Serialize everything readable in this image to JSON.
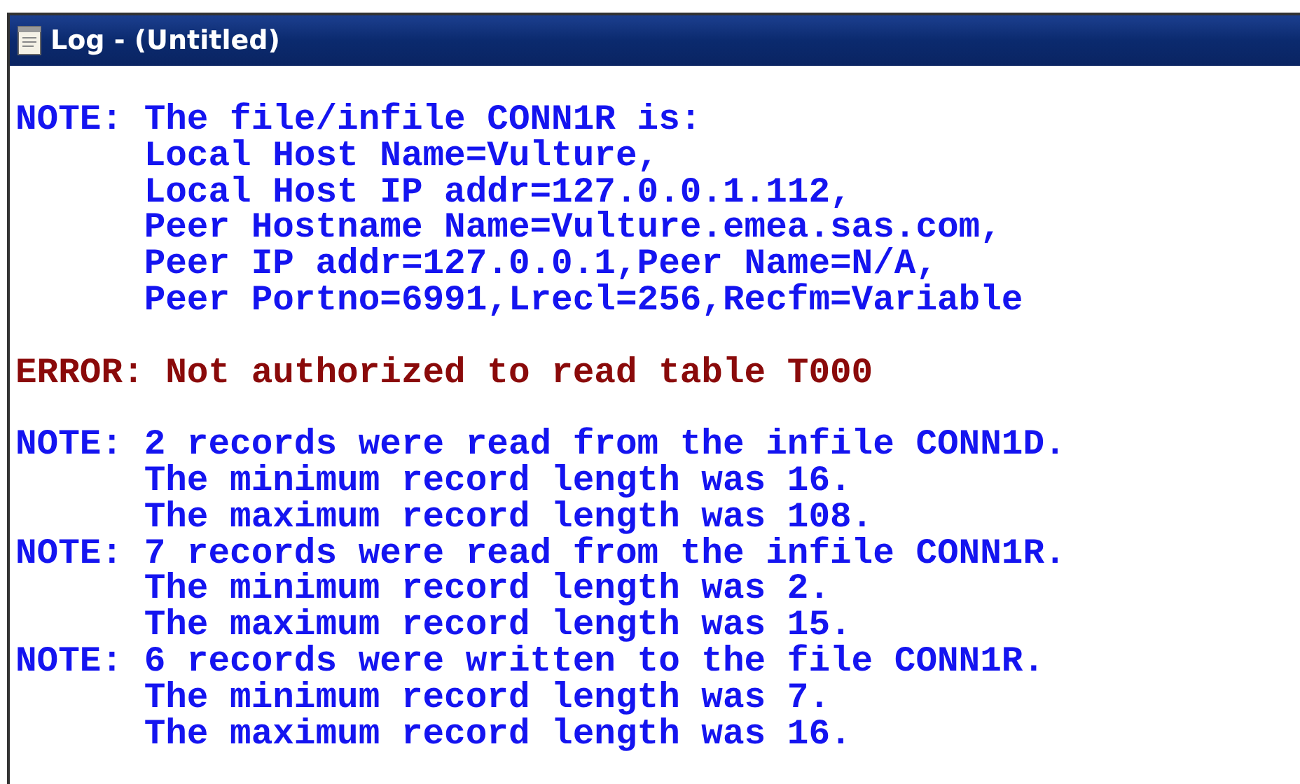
{
  "window": {
    "title": "Log - (Untitled)"
  },
  "log": {
    "sections": [
      [
        {
          "kind": "note",
          "label": "NOTE:",
          "lines": [
            "The file/infile CONN1R is:",
            "Local Host Name=Vulture,",
            "Local Host IP addr=127.0.0.1.112,",
            "Peer Hostname Name=Vulture.emea.sas.com,",
            "Peer IP addr=127.0.0.1,Peer Name=N/A,",
            "Peer Portno=6991,Lrecl=256,Recfm=Variable"
          ]
        }
      ],
      [
        {
          "kind": "error",
          "label": "ERROR:",
          "lines": [
            "Not authorized to read table T000"
          ]
        }
      ],
      [
        {
          "kind": "note",
          "label": "NOTE:",
          "lines": [
            "2 records were read from the infile CONN1D.",
            "The minimum record length was 16.",
            "The maximum record length was 108."
          ]
        },
        {
          "kind": "note",
          "label": "NOTE:",
          "lines": [
            "7 records were read from the infile CONN1R.",
            "The minimum record length was 2.",
            "The maximum record length was 15."
          ]
        },
        {
          "kind": "note",
          "label": "NOTE:",
          "lines": [
            "6 records were written to the file CONN1R.",
            "The minimum record length was 7.",
            "The maximum record length was 16."
          ]
        }
      ]
    ]
  }
}
